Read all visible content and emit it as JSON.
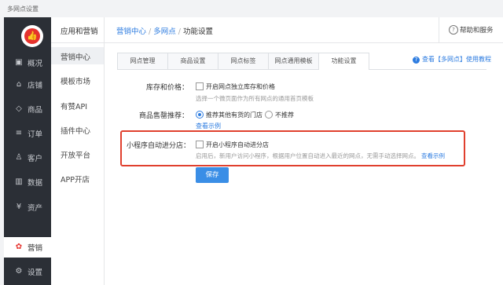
{
  "window": {
    "title": "多网点设置"
  },
  "sidebar": {
    "logo_icon": "thumbs-up-icon",
    "items": [
      {
        "label": "概况",
        "icon": "overview-icon"
      },
      {
        "label": "店铺",
        "icon": "store-icon"
      },
      {
        "label": "商品",
        "icon": "tag-icon"
      },
      {
        "label": "订单",
        "icon": "order-icon"
      },
      {
        "label": "客户",
        "icon": "user-icon"
      },
      {
        "label": "数据",
        "icon": "chart-icon"
      },
      {
        "label": "资产",
        "icon": "asset-icon"
      },
      {
        "label": "营销",
        "icon": "marketing-icon",
        "active": true
      },
      {
        "label": "设置",
        "icon": "gear-icon"
      }
    ]
  },
  "subnav": {
    "title": "应用和营销",
    "items": [
      {
        "label": "营销中心",
        "active": true
      },
      {
        "label": "模板市场"
      },
      {
        "label": "有赞API"
      },
      {
        "label": "插件中心"
      },
      {
        "label": "开放平台"
      },
      {
        "label": "APP开店"
      }
    ]
  },
  "header": {
    "breadcrumb": [
      "营销中心",
      "多网点",
      "功能设置"
    ],
    "help_label": "帮助和服务"
  },
  "tabs": [
    "网点管理",
    "商品设置",
    "网点标签",
    "网点通用模板",
    "功能设置"
  ],
  "active_tab": "功能设置",
  "tutorial_link": "查看【多网点】使用教程",
  "settings": {
    "inventory": {
      "label": "库存和价格：",
      "option": "开启网点独立库存和价格",
      "hint": "选择一个微页面作为所有网点的通用首页模板"
    },
    "soldout": {
      "label": "商品售罄推荐：",
      "option_1": "推荐其他有货的门店",
      "option_2": "不推荐",
      "example": "查看示例"
    },
    "miniapp": {
      "label": "小程序自动进分店：",
      "option": "开启小程序自动进分店",
      "hint": "启用后，新用户访问小程序，根据用户位置自动进入最近的网点，无需手动选择网点。",
      "example": "查看示例"
    }
  },
  "save_label": "保存",
  "colors": {
    "accent": "#2d7ce0",
    "highlight": "#e0402e",
    "sidebar_bg": "#2b2f36",
    "button": "#3a8ee6"
  }
}
